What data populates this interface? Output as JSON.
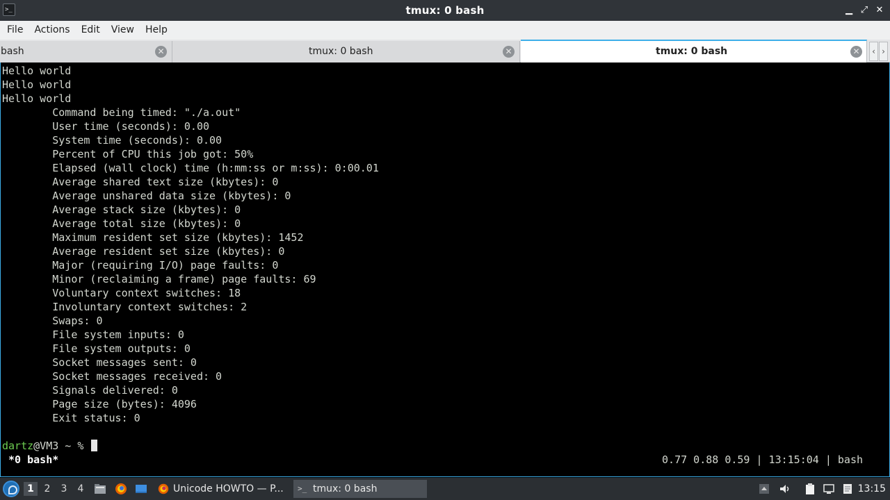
{
  "window": {
    "title": "tmux: 0 bash",
    "app_icon": "terminal-icon"
  },
  "menu": [
    "File",
    "Actions",
    "Edit",
    "View",
    "Help"
  ],
  "tabs": [
    {
      "label": "bash"
    },
    {
      "label": "tmux: 0 bash"
    },
    {
      "label": "tmux: 0 bash",
      "active": true
    }
  ],
  "terminal": {
    "lines": [
      "Hello world",
      "Hello world",
      "Hello world",
      "\tCommand being timed: \"./a.out\"",
      "\tUser time (seconds): 0.00",
      "\tSystem time (seconds): 0.00",
      "\tPercent of CPU this job got: 50%",
      "\tElapsed (wall clock) time (h:mm:ss or m:ss): 0:00.01",
      "\tAverage shared text size (kbytes): 0",
      "\tAverage unshared data size (kbytes): 0",
      "\tAverage stack size (kbytes): 0",
      "\tAverage total size (kbytes): 0",
      "\tMaximum resident set size (kbytes): 1452",
      "\tAverage resident set size (kbytes): 0",
      "\tMajor (requiring I/O) page faults: 0",
      "\tMinor (reclaiming a frame) page faults: 69",
      "\tVoluntary context switches: 18",
      "\tInvoluntary context switches: 2",
      "\tSwaps: 0",
      "\tFile system inputs: 0",
      "\tFile system outputs: 0",
      "\tSocket messages sent: 0",
      "\tSocket messages received: 0",
      "\tSignals delivered: 0",
      "\tPage size (bytes): 4096",
      "\tExit status: 0"
    ],
    "prompt_user": "dartz",
    "prompt_rest": "@VM3 ~ % ",
    "status_left": " *0 bash*",
    "status_right": "0.77 0.88 0.59 | 13:15:04 | bash"
  },
  "taskbar": {
    "desktops": [
      "1",
      "2",
      "3",
      "4"
    ],
    "active_desktop": "1",
    "tasks": [
      {
        "label": "Unicode HOWTO — P...",
        "icon": "firefox-icon"
      },
      {
        "label": "tmux: 0 bash",
        "icon": "terminal-icon",
        "active": true
      }
    ],
    "clock": "13:15"
  },
  "colors": {
    "accent": "#3daee9",
    "prompt_user": "#6ccb50",
    "terminal_bg": "#000000",
    "terminal_fg": "#d3d7cf"
  }
}
